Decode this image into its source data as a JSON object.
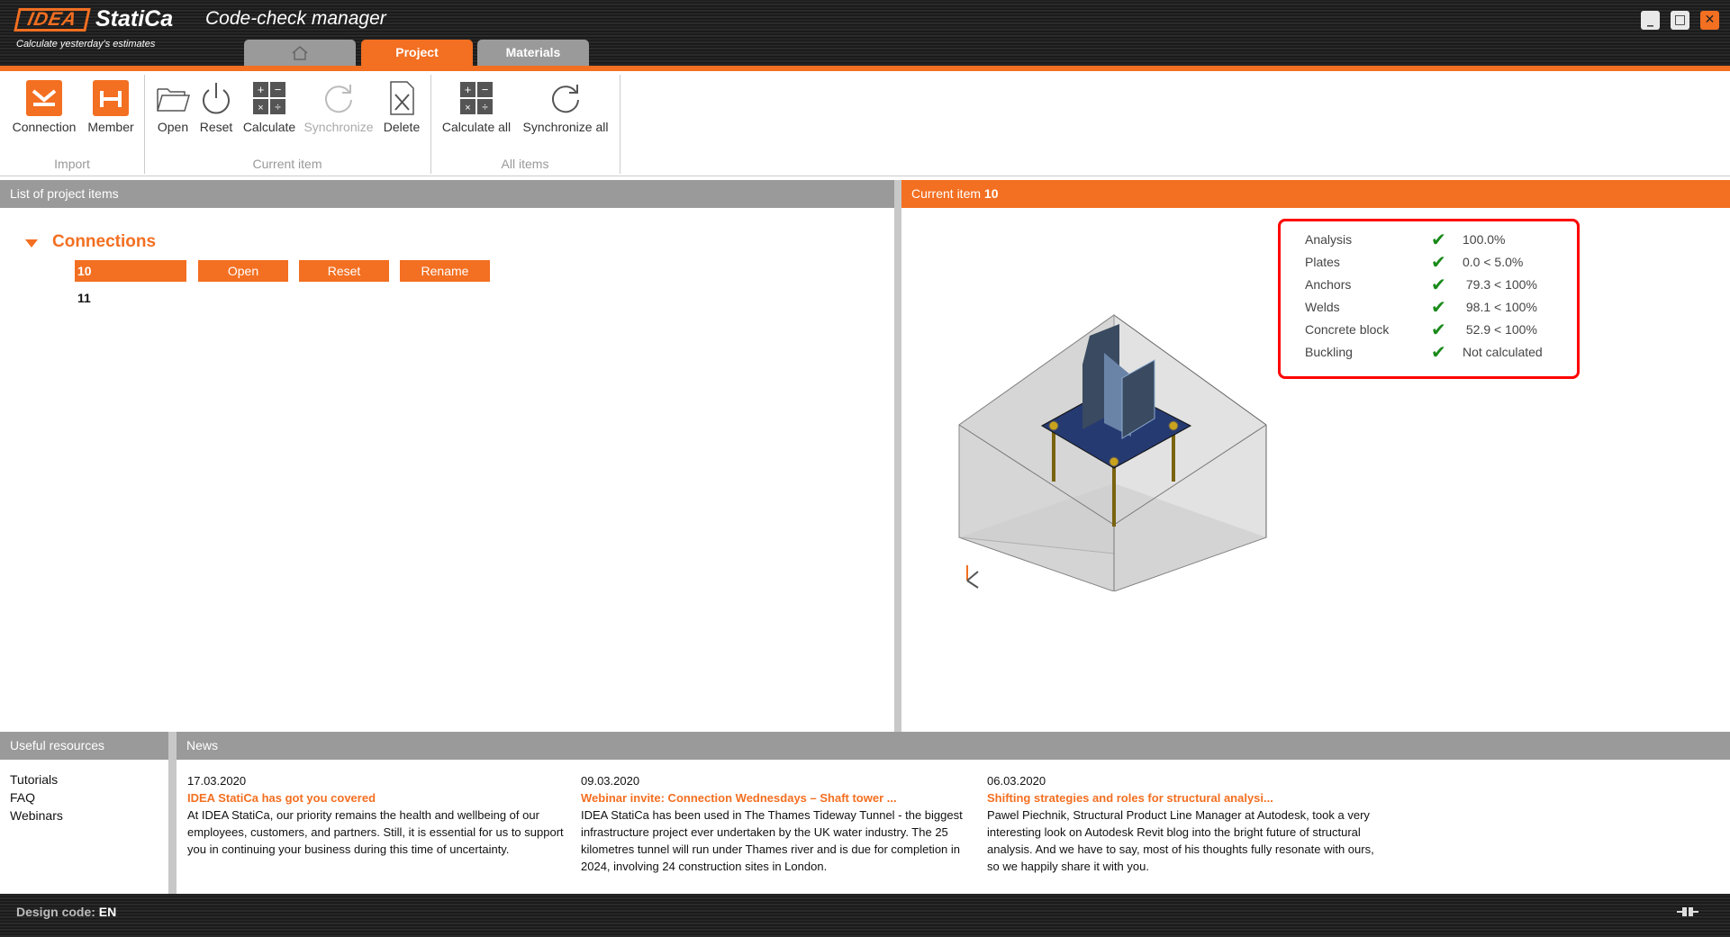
{
  "header": {
    "logo_idea": "IDEA",
    "logo_statica": "StatiCa",
    "app_title": "Code-check manager",
    "tagline": "Calculate yesterday's estimates",
    "tabs": [
      {
        "label": "",
        "icon": "home-icon"
      },
      {
        "label": "Project",
        "active": true
      },
      {
        "label": "Materials"
      }
    ],
    "window_controls": {
      "minimize": "_",
      "maximize": "□",
      "close": "✕"
    }
  },
  "ribbon": {
    "groups": [
      {
        "label": "Import",
        "buttons": [
          {
            "label": "Connection",
            "icon": "connection-import-icon"
          },
          {
            "label": "Member",
            "icon": "member-import-icon"
          }
        ]
      },
      {
        "label": "Current item",
        "buttons": [
          {
            "label": "Open",
            "icon": "folder-icon"
          },
          {
            "label": "Reset",
            "icon": "power-icon"
          },
          {
            "label": "Calculate",
            "icon": "calculator-icon"
          },
          {
            "label": "Synchronize",
            "icon": "refresh-icon",
            "disabled": true
          },
          {
            "label": "Delete",
            "icon": "delete-file-icon"
          }
        ]
      },
      {
        "label": "All items",
        "buttons": [
          {
            "label": "Calculate all",
            "icon": "calculator-icon"
          },
          {
            "label": "Synchronize all",
            "icon": "refresh-icon"
          }
        ]
      }
    ]
  },
  "left_panel": {
    "title": "List of project items",
    "group": "Connections",
    "items": [
      {
        "name": "10",
        "selected": true,
        "actions": [
          "Open",
          "Reset",
          "Rename"
        ]
      },
      {
        "name": "11"
      }
    ]
  },
  "right_panel": {
    "title": "Current item",
    "item": "10",
    "results": [
      {
        "label": "Analysis",
        "value": "100.0%"
      },
      {
        "label": "Plates",
        "value": "0.0 < 5.0%"
      },
      {
        "label": "Anchors",
        "value": " 79.3 < 100%"
      },
      {
        "label": "Welds",
        "value": " 98.1 < 100%"
      },
      {
        "label": "Concrete block",
        "value": " 52.9 < 100%"
      },
      {
        "label": "Buckling",
        "value": "Not calculated"
      }
    ],
    "check_mark": "✔",
    "status_color": "#1a8a1a"
  },
  "resources": {
    "title": "Useful resources",
    "links": [
      "Tutorials",
      "FAQ",
      "Webinars"
    ]
  },
  "news": {
    "title": "News",
    "items": [
      {
        "date": "17.03.2020",
        "title": "IDEA StatiCa has got you covered",
        "text": "At IDEA StatiCa, our priority remains the health and wellbeing of our employees, customers, and partners. Still, it is essential for us to support you in continuing your business during this time of uncertainty."
      },
      {
        "date": "09.03.2020",
        "title": "Webinar invite: Connection Wednesdays – Shaft tower ...",
        "text": "IDEA StatiCa has been used in The Thames Tideway Tunnel - the biggest infrastructure project ever undertaken by the UK water industry. The 25 kilometres tunnel will run under Thames river and is due for completion in 2024, involving 24 construction sites in London."
      },
      {
        "date": "06.03.2020",
        "title": "Shifting strategies and roles for structural analysi...",
        "text": "Pawel Piechnik, Structural Product Line Manager at Autodesk, took a very interesting look on Autodesk Revit blog into the bright future of structural analysis. And we have to say, most of his thoughts fully resonate with ours, so we happily share it with you."
      }
    ]
  },
  "footer": {
    "design_code_label": "Design code:",
    "design_code": "EN",
    "connection_icon": "plug-icon"
  },
  "colors": {
    "accent": "#f36f21",
    "header_gray": "#9a9a9a",
    "highlight": "#ff0000"
  }
}
